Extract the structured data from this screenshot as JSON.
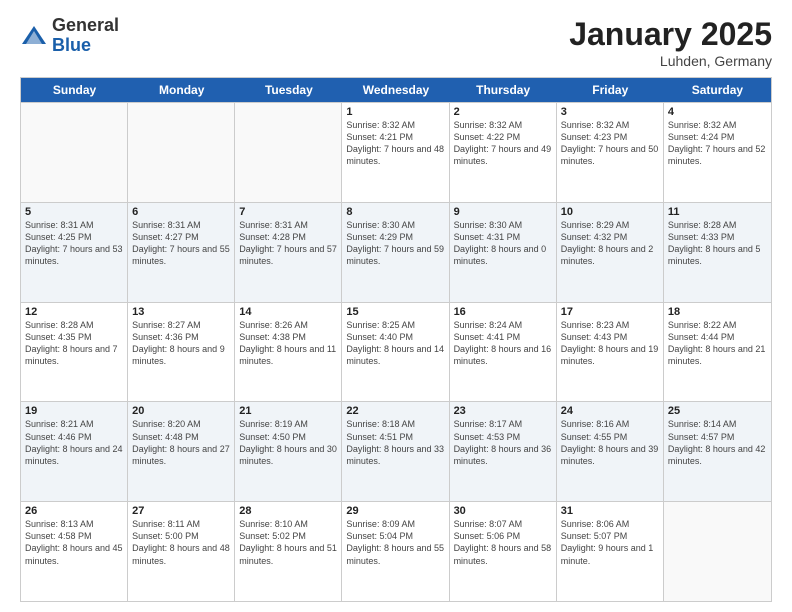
{
  "logo": {
    "general": "General",
    "blue": "Blue"
  },
  "title": {
    "month": "January 2025",
    "location": "Luhden, Germany"
  },
  "header_days": [
    "Sunday",
    "Monday",
    "Tuesday",
    "Wednesday",
    "Thursday",
    "Friday",
    "Saturday"
  ],
  "rows": [
    [
      {
        "day": "",
        "sunrise": "",
        "sunset": "",
        "daylight": "",
        "empty": true
      },
      {
        "day": "",
        "sunrise": "",
        "sunset": "",
        "daylight": "",
        "empty": true
      },
      {
        "day": "",
        "sunrise": "",
        "sunset": "",
        "daylight": "",
        "empty": true
      },
      {
        "day": "1",
        "sunrise": "Sunrise: 8:32 AM",
        "sunset": "Sunset: 4:21 PM",
        "daylight": "Daylight: 7 hours and 48 minutes.",
        "empty": false
      },
      {
        "day": "2",
        "sunrise": "Sunrise: 8:32 AM",
        "sunset": "Sunset: 4:22 PM",
        "daylight": "Daylight: 7 hours and 49 minutes.",
        "empty": false
      },
      {
        "day": "3",
        "sunrise": "Sunrise: 8:32 AM",
        "sunset": "Sunset: 4:23 PM",
        "daylight": "Daylight: 7 hours and 50 minutes.",
        "empty": false
      },
      {
        "day": "4",
        "sunrise": "Sunrise: 8:32 AM",
        "sunset": "Sunset: 4:24 PM",
        "daylight": "Daylight: 7 hours and 52 minutes.",
        "empty": false
      }
    ],
    [
      {
        "day": "5",
        "sunrise": "Sunrise: 8:31 AM",
        "sunset": "Sunset: 4:25 PM",
        "daylight": "Daylight: 7 hours and 53 minutes.",
        "empty": false
      },
      {
        "day": "6",
        "sunrise": "Sunrise: 8:31 AM",
        "sunset": "Sunset: 4:27 PM",
        "daylight": "Daylight: 7 hours and 55 minutes.",
        "empty": false
      },
      {
        "day": "7",
        "sunrise": "Sunrise: 8:31 AM",
        "sunset": "Sunset: 4:28 PM",
        "daylight": "Daylight: 7 hours and 57 minutes.",
        "empty": false
      },
      {
        "day": "8",
        "sunrise": "Sunrise: 8:30 AM",
        "sunset": "Sunset: 4:29 PM",
        "daylight": "Daylight: 7 hours and 59 minutes.",
        "empty": false
      },
      {
        "day": "9",
        "sunrise": "Sunrise: 8:30 AM",
        "sunset": "Sunset: 4:31 PM",
        "daylight": "Daylight: 8 hours and 0 minutes.",
        "empty": false
      },
      {
        "day": "10",
        "sunrise": "Sunrise: 8:29 AM",
        "sunset": "Sunset: 4:32 PM",
        "daylight": "Daylight: 8 hours and 2 minutes.",
        "empty": false
      },
      {
        "day": "11",
        "sunrise": "Sunrise: 8:28 AM",
        "sunset": "Sunset: 4:33 PM",
        "daylight": "Daylight: 8 hours and 5 minutes.",
        "empty": false
      }
    ],
    [
      {
        "day": "12",
        "sunrise": "Sunrise: 8:28 AM",
        "sunset": "Sunset: 4:35 PM",
        "daylight": "Daylight: 8 hours and 7 minutes.",
        "empty": false
      },
      {
        "day": "13",
        "sunrise": "Sunrise: 8:27 AM",
        "sunset": "Sunset: 4:36 PM",
        "daylight": "Daylight: 8 hours and 9 minutes.",
        "empty": false
      },
      {
        "day": "14",
        "sunrise": "Sunrise: 8:26 AM",
        "sunset": "Sunset: 4:38 PM",
        "daylight": "Daylight: 8 hours and 11 minutes.",
        "empty": false
      },
      {
        "day": "15",
        "sunrise": "Sunrise: 8:25 AM",
        "sunset": "Sunset: 4:40 PM",
        "daylight": "Daylight: 8 hours and 14 minutes.",
        "empty": false
      },
      {
        "day": "16",
        "sunrise": "Sunrise: 8:24 AM",
        "sunset": "Sunset: 4:41 PM",
        "daylight": "Daylight: 8 hours and 16 minutes.",
        "empty": false
      },
      {
        "day": "17",
        "sunrise": "Sunrise: 8:23 AM",
        "sunset": "Sunset: 4:43 PM",
        "daylight": "Daylight: 8 hours and 19 minutes.",
        "empty": false
      },
      {
        "day": "18",
        "sunrise": "Sunrise: 8:22 AM",
        "sunset": "Sunset: 4:44 PM",
        "daylight": "Daylight: 8 hours and 21 minutes.",
        "empty": false
      }
    ],
    [
      {
        "day": "19",
        "sunrise": "Sunrise: 8:21 AM",
        "sunset": "Sunset: 4:46 PM",
        "daylight": "Daylight: 8 hours and 24 minutes.",
        "empty": false
      },
      {
        "day": "20",
        "sunrise": "Sunrise: 8:20 AM",
        "sunset": "Sunset: 4:48 PM",
        "daylight": "Daylight: 8 hours and 27 minutes.",
        "empty": false
      },
      {
        "day": "21",
        "sunrise": "Sunrise: 8:19 AM",
        "sunset": "Sunset: 4:50 PM",
        "daylight": "Daylight: 8 hours and 30 minutes.",
        "empty": false
      },
      {
        "day": "22",
        "sunrise": "Sunrise: 8:18 AM",
        "sunset": "Sunset: 4:51 PM",
        "daylight": "Daylight: 8 hours and 33 minutes.",
        "empty": false
      },
      {
        "day": "23",
        "sunrise": "Sunrise: 8:17 AM",
        "sunset": "Sunset: 4:53 PM",
        "daylight": "Daylight: 8 hours and 36 minutes.",
        "empty": false
      },
      {
        "day": "24",
        "sunrise": "Sunrise: 8:16 AM",
        "sunset": "Sunset: 4:55 PM",
        "daylight": "Daylight: 8 hours and 39 minutes.",
        "empty": false
      },
      {
        "day": "25",
        "sunrise": "Sunrise: 8:14 AM",
        "sunset": "Sunset: 4:57 PM",
        "daylight": "Daylight: 8 hours and 42 minutes.",
        "empty": false
      }
    ],
    [
      {
        "day": "26",
        "sunrise": "Sunrise: 8:13 AM",
        "sunset": "Sunset: 4:58 PM",
        "daylight": "Daylight: 8 hours and 45 minutes.",
        "empty": false
      },
      {
        "day": "27",
        "sunrise": "Sunrise: 8:11 AM",
        "sunset": "Sunset: 5:00 PM",
        "daylight": "Daylight: 8 hours and 48 minutes.",
        "empty": false
      },
      {
        "day": "28",
        "sunrise": "Sunrise: 8:10 AM",
        "sunset": "Sunset: 5:02 PM",
        "daylight": "Daylight: 8 hours and 51 minutes.",
        "empty": false
      },
      {
        "day": "29",
        "sunrise": "Sunrise: 8:09 AM",
        "sunset": "Sunset: 5:04 PM",
        "daylight": "Daylight: 8 hours and 55 minutes.",
        "empty": false
      },
      {
        "day": "30",
        "sunrise": "Sunrise: 8:07 AM",
        "sunset": "Sunset: 5:06 PM",
        "daylight": "Daylight: 8 hours and 58 minutes.",
        "empty": false
      },
      {
        "day": "31",
        "sunrise": "Sunrise: 8:06 AM",
        "sunset": "Sunset: 5:07 PM",
        "daylight": "Daylight: 9 hours and 1 minute.",
        "empty": false
      },
      {
        "day": "",
        "sunrise": "",
        "sunset": "",
        "daylight": "",
        "empty": true
      }
    ]
  ]
}
